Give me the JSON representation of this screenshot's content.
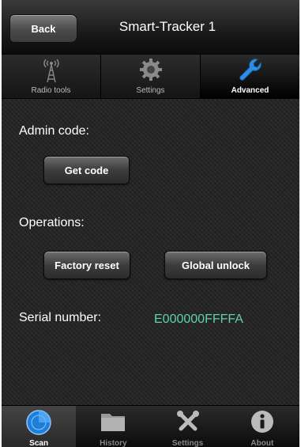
{
  "navbar": {
    "back_label": "Back",
    "title": "Smart-Tracker 1"
  },
  "segments": [
    {
      "label": "Radio tools",
      "icon": "radio-tower-icon"
    },
    {
      "label": "Settings",
      "icon": "gear-icon"
    },
    {
      "label": "Advanced",
      "icon": "wrench-icon",
      "active": true
    }
  ],
  "admin": {
    "label": "Admin code:",
    "button": "Get code"
  },
  "operations": {
    "label": "Operations:",
    "reset": "Factory reset",
    "unlock": "Global unlock"
  },
  "serial": {
    "label": "Serial number:",
    "value": "E000000FFFFA"
  },
  "tabbar": [
    {
      "label": "Scan",
      "icon": "radar-icon",
      "active": true
    },
    {
      "label": "History",
      "icon": "folder-icon"
    },
    {
      "label": "Settings",
      "icon": "tools-icon"
    },
    {
      "label": "About",
      "icon": "info-icon"
    }
  ],
  "colors": {
    "accent": "#2a8de8",
    "serial": "#5fd3a8"
  }
}
